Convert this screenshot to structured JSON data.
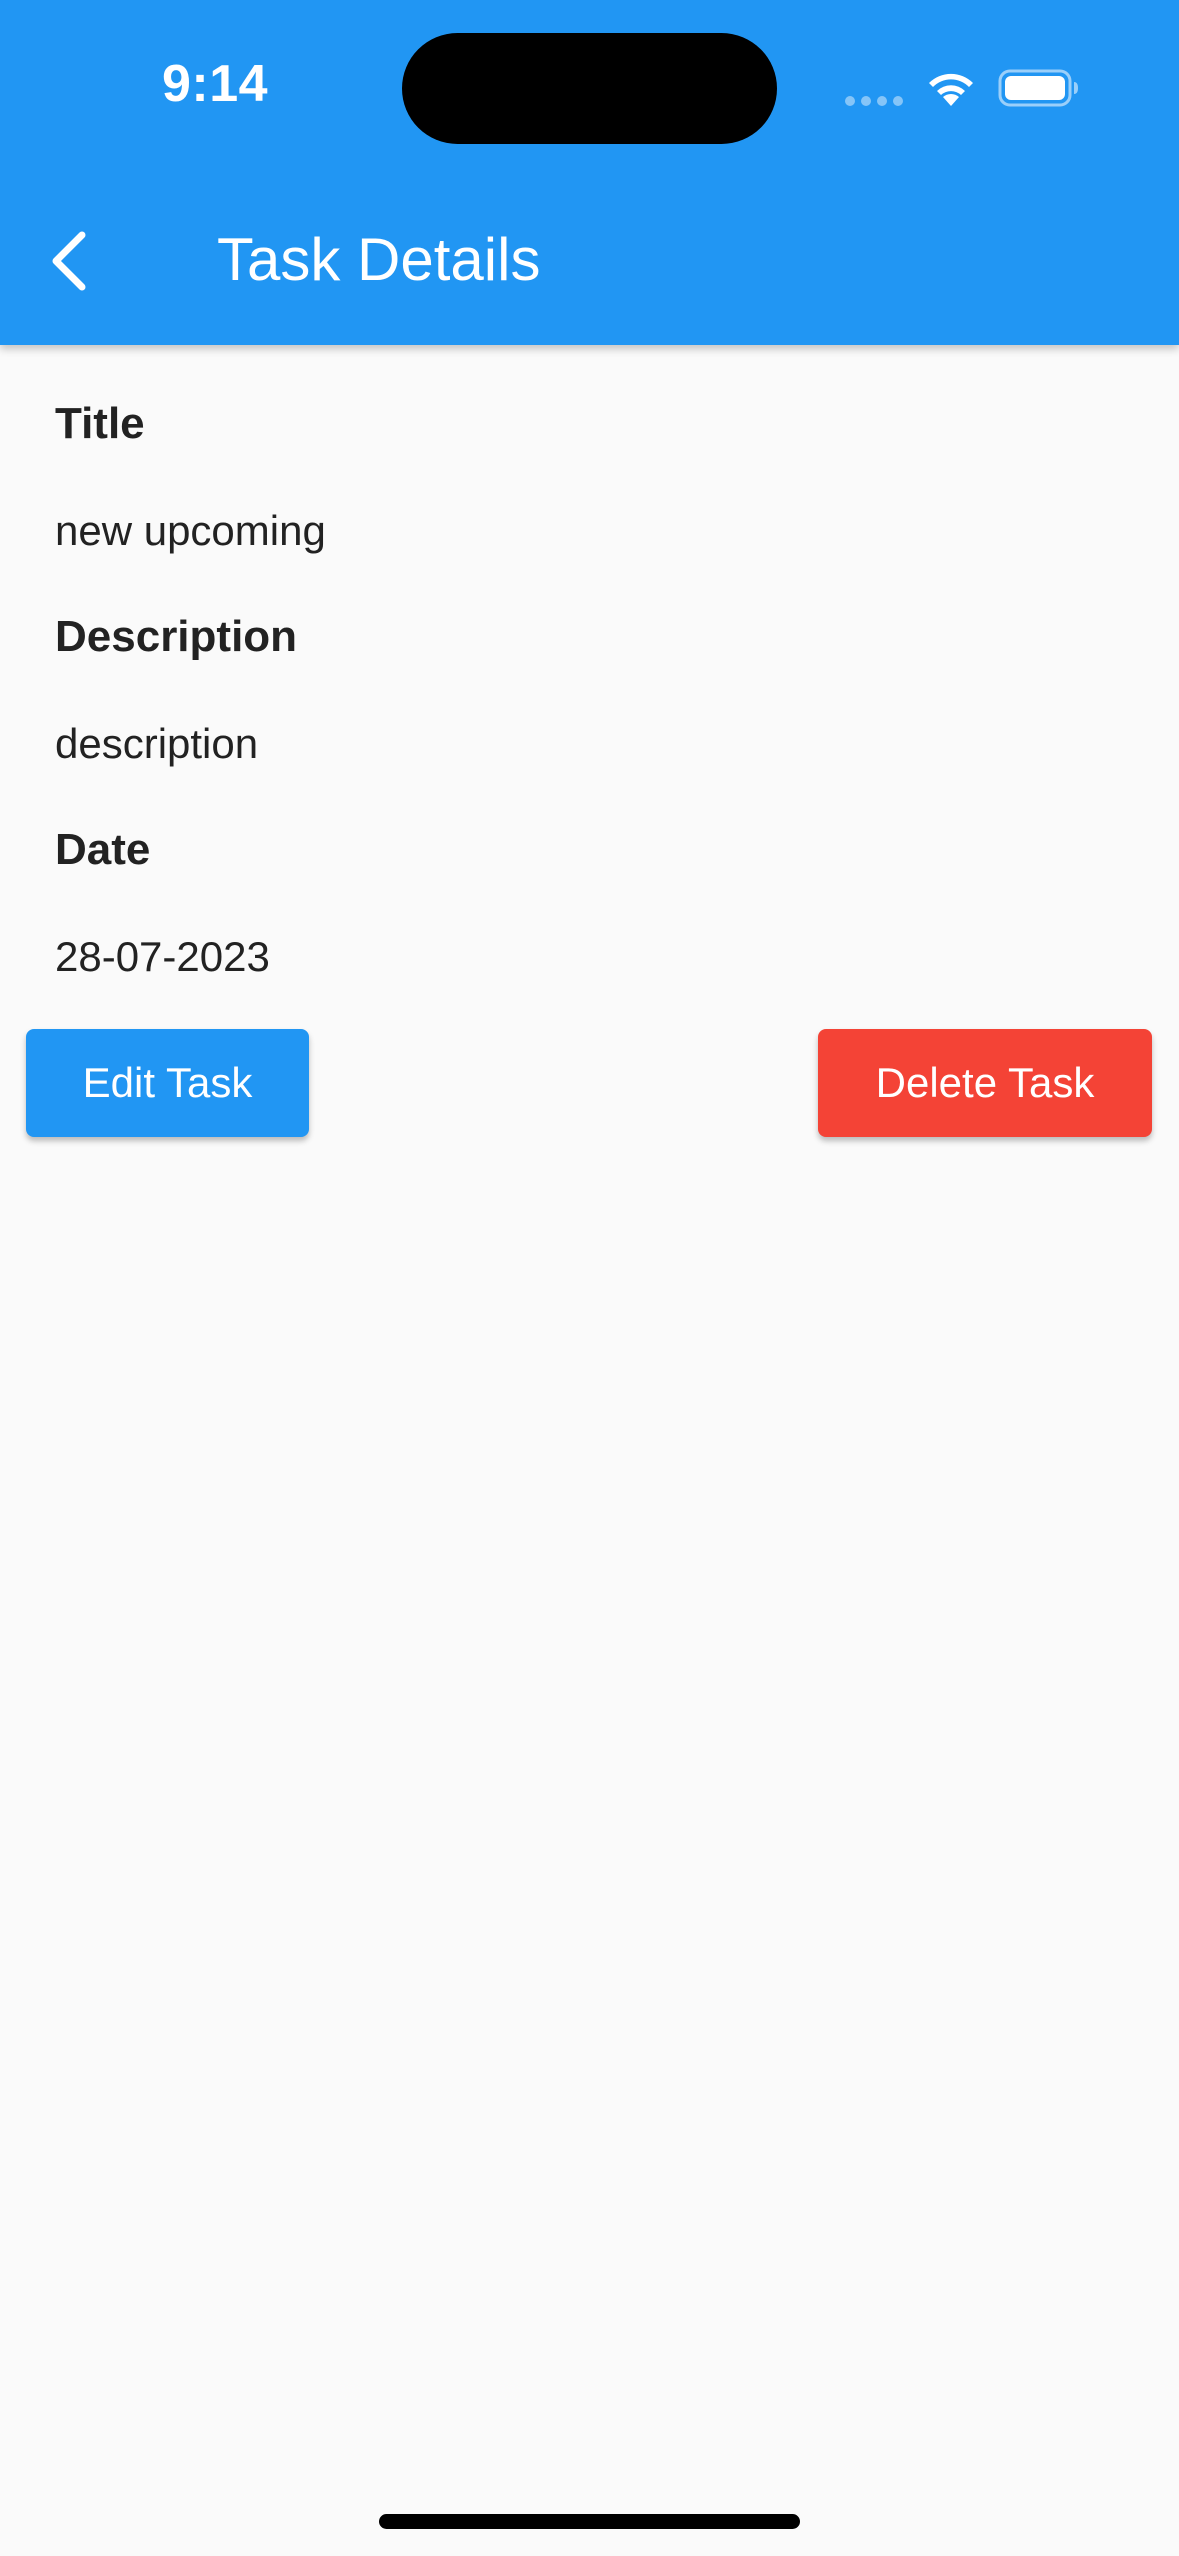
{
  "status_bar": {
    "time": "9:14"
  },
  "app_bar": {
    "title": "Task Details",
    "back_icon": "chevron-left-icon"
  },
  "task": {
    "fields": [
      {
        "label": "Title",
        "value": "new upcoming"
      },
      {
        "label": "Description",
        "value": "description"
      },
      {
        "label": "Date",
        "value": "28-07-2023"
      }
    ]
  },
  "actions": {
    "edit_label": "Edit Task",
    "delete_label": "Delete Task"
  },
  "colors": {
    "primary": "#2196f3",
    "danger": "#f44336",
    "background": "#fafafa",
    "text": "#222222"
  }
}
